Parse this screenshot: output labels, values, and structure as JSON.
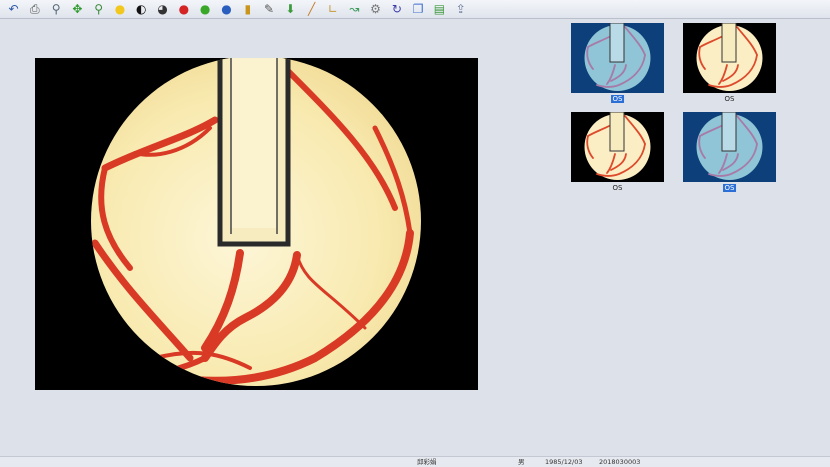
{
  "toolbar": {
    "items": [
      {
        "icon": "undo-icon",
        "glyph": "↶",
        "color": "#2e59a8"
      },
      {
        "icon": "printer-icon",
        "glyph": "⎙",
        "color": "#555555"
      },
      {
        "icon": "zoom-icon",
        "glyph": "⚲",
        "color": "#556677"
      },
      {
        "icon": "move-icon",
        "glyph": "✥",
        "color": "#2f9a2f"
      },
      {
        "icon": "magic-wand-icon",
        "glyph": "⚲",
        "color": "#3c8a3c"
      },
      {
        "icon": "brightness-icon",
        "glyph": "●",
        "color": "#f2c81e"
      },
      {
        "icon": "contrast-icon",
        "glyph": "◐",
        "color": "#111111"
      },
      {
        "icon": "gamma-icon",
        "glyph": "◕",
        "color": "#333333"
      },
      {
        "icon": "red-channel-icon",
        "glyph": "●",
        "color": "#d42424"
      },
      {
        "icon": "green-channel-icon",
        "glyph": "●",
        "color": "#39a828"
      },
      {
        "icon": "blue-channel-icon",
        "glyph": "●",
        "color": "#2b5fbf"
      },
      {
        "icon": "histogram-icon",
        "glyph": "▮",
        "color": "#c9951c"
      },
      {
        "icon": "pencil-icon",
        "glyph": "✎",
        "color": "#555555"
      },
      {
        "icon": "download-icon",
        "glyph": "⬇",
        "color": "#3b9a3b"
      },
      {
        "icon": "ruler-icon",
        "glyph": "╱",
        "color": "#c87b2b"
      },
      {
        "icon": "angle-icon",
        "glyph": "∟",
        "color": "#c89a3a"
      },
      {
        "icon": "curve-icon",
        "glyph": "↝",
        "color": "#3a9a5a"
      },
      {
        "icon": "report-icon",
        "glyph": "⚙",
        "color": "#777777"
      },
      {
        "icon": "rotate-icon",
        "glyph": "↻",
        "color": "#3d3da8"
      },
      {
        "icon": "copy-icon",
        "glyph": "❐",
        "color": "#3f6fcf"
      },
      {
        "icon": "image-icon",
        "glyph": "▤",
        "color": "#3d9a3d"
      },
      {
        "icon": "export-icon",
        "glyph": "⇪",
        "color": "#6a7a9a"
      }
    ]
  },
  "thumbnails": [
    {
      "label": "OS",
      "selected": true,
      "variant": "blue"
    },
    {
      "label": "OS",
      "selected": false,
      "variant": "normal"
    },
    {
      "label": "OS",
      "selected": false,
      "variant": "normal"
    },
    {
      "label": "OS",
      "selected": true,
      "variant": "blue"
    }
  ],
  "statusbar": {
    "name": "邱彩娟",
    "gender": "男",
    "birthdate": "1985/12/03",
    "record_id": "2018030003"
  }
}
